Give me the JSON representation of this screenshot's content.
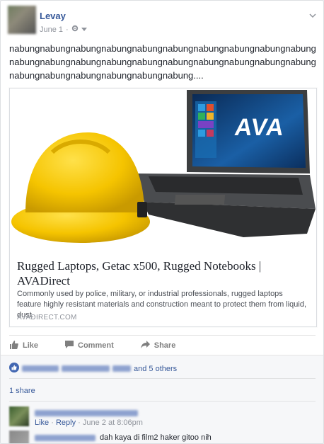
{
  "post": {
    "author": "Levay",
    "date": "June 1",
    "text": "nabungnabungnabungnabungnabungnabungnabungnabungnabungnabungnabungnabungnabungnabungnabungnabungnabungnabungnabungnabungnabungnabungnabungnabungnabungnabung....",
    "icons": {
      "privacy": "gear-icon",
      "menu": "chevron-down-icon"
    }
  },
  "link_preview": {
    "title": "Rugged Laptops, Getac x500, Rugged Notebooks | AVADirect",
    "description": "Commonly used by police, military, or industrial professionals, rugged laptops feature highly resistant materials and construction meant to protect them from liquid, dust....",
    "domain": "AVADIRECT.COM",
    "brand": "AVA"
  },
  "actions": {
    "like": "Like",
    "comment": "Comment",
    "share": "Share"
  },
  "reactions": {
    "others": "and 5 others"
  },
  "shares": "1 share",
  "comments": [
    {
      "actions": {
        "like": "Like",
        "reply": "Reply",
        "time": "June 2 at 8:06pm",
        "sep": "·"
      }
    },
    {
      "text": "dah kaya di film2 haker gitoo nih"
    }
  ],
  "colors": {
    "link": "#365899",
    "muted": "#90949c",
    "accent": "#4267b2"
  }
}
